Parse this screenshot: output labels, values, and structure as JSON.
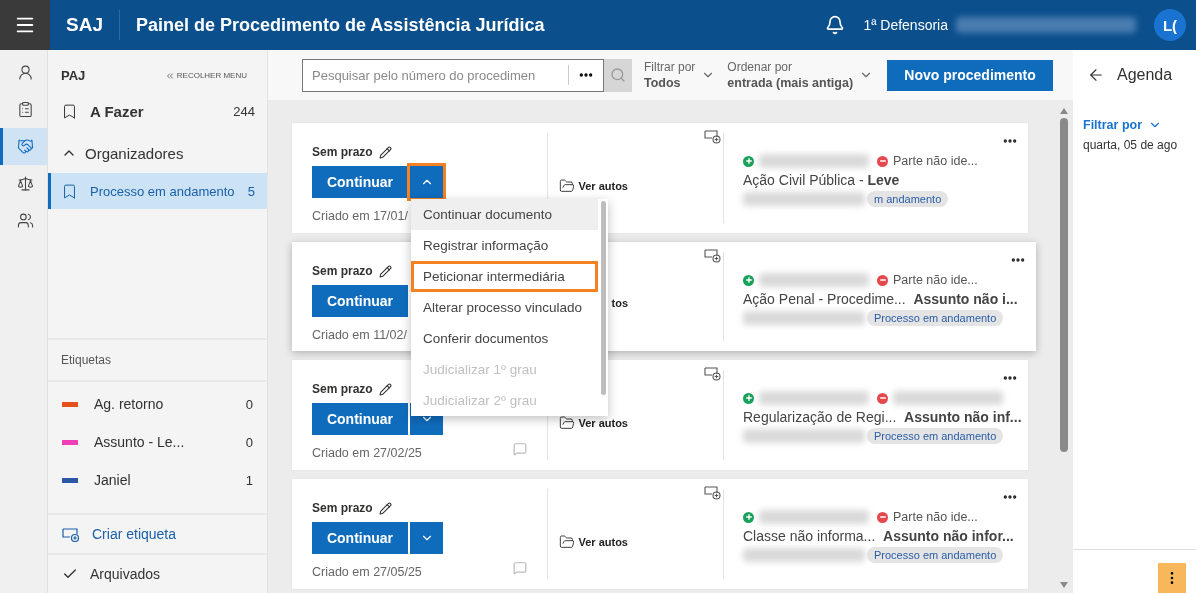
{
  "topbar": {
    "brand": "SAJ",
    "title": "Painel de Procedimento de Assistência Jurídica",
    "unit": "1ª Defensoria",
    "avatar": "L("
  },
  "rail": [
    {
      "kind": "person",
      "selected": false
    },
    {
      "kind": "clipboard",
      "selected": false
    },
    {
      "kind": "handshake",
      "selected": true
    },
    {
      "kind": "scale",
      "selected": false
    },
    {
      "kind": "group",
      "selected": false
    }
  ],
  "sidebar": {
    "title": "PAJ",
    "collapse": "RECOLHER MENU",
    "items": [
      {
        "label": "A Fazer",
        "count": "244",
        "selected": false
      }
    ],
    "organizers": {
      "label": "Organizadores",
      "expanded": true,
      "items": [
        {
          "label": "Processo em andamento",
          "count": "5",
          "selected": true
        }
      ]
    },
    "labels_title": "Etiquetas",
    "labels": [
      {
        "label": "Ag. retorno",
        "count": "0",
        "color": "#e5501c"
      },
      {
        "label": "Assunto - Le...",
        "count": "0",
        "color": "#ee3fb9"
      },
      {
        "label": "Janiel",
        "count": "1",
        "color": "#2b58a6"
      }
    ],
    "create_label": "Criar etiqueta",
    "archived": "Arquivados"
  },
  "toolbar": {
    "search_placeholder": "Pesquisar pelo número do procedimen",
    "filter": {
      "label": "Filtrar por",
      "value": "Todos"
    },
    "sort": {
      "label": "Ordenar por",
      "value": "entrada (mais antiga)"
    },
    "new_button": "Novo procedimento"
  },
  "cards": [
    {
      "deadline": "Sem prazo",
      "action": "Continuar",
      "menu_open": true,
      "dropdown": true,
      "highlighted": true,
      "created": "Criado em 17/01/",
      "comment": false,
      "folder_icon": true,
      "link": "Ver autos",
      "elevated": false,
      "parties": [
        {
          "kind": "plus",
          "redacted": true
        },
        {
          "kind": "minus",
          "name": "Parte não ide..."
        }
      ],
      "title": "Ação Civil Pública - **Leve**",
      "tag": "m andamento"
    },
    {
      "deadline": "Sem prazo",
      "action": "Continuar",
      "menu_open": false,
      "dropdown": false,
      "highlighted": false,
      "created": "Criado em 11/02/",
      "comment": false,
      "folder_icon": false,
      "link": "tos",
      "elevated": true,
      "parties": [
        {
          "kind": "plus",
          "redacted": true
        },
        {
          "kind": "minus",
          "name": "Parte não ide..."
        }
      ],
      "title": "Ação Penal - Procedime...  **Assunto não i...**",
      "tag": "Processo em andamento"
    },
    {
      "deadline": "Sem prazo",
      "action": "Continuar",
      "menu_open": false,
      "dropdown": true,
      "highlighted": false,
      "created": "Criado em 27/02/25",
      "comment": true,
      "folder_icon": true,
      "link": "Ver autos",
      "elevated": false,
      "parties": [
        {
          "kind": "plus",
          "redacted": true
        },
        {
          "kind": "minus",
          "redacted": true
        }
      ],
      "title": "Regularização de Regi...  **Assunto não inf...**",
      "tag": "Processo em andamento"
    },
    {
      "deadline": "Sem prazo",
      "action": "Continuar",
      "menu_open": false,
      "dropdown": true,
      "highlighted": false,
      "created": "Criado em 27/05/25",
      "comment": true,
      "folder_icon": true,
      "link": "Ver autos",
      "elevated": false,
      "parties": [
        {
          "kind": "plus",
          "redacted": true
        },
        {
          "kind": "minus",
          "name": "Parte não ide..."
        }
      ],
      "title": "Classe não informa...  **Assunto não infor...**",
      "tag": "Processo em andamento"
    }
  ],
  "menu": {
    "items": [
      {
        "label": "Continuar documento",
        "hovered": true,
        "disabled": false,
        "highlighted": false
      },
      {
        "label": "Registrar informação",
        "hovered": false,
        "disabled": false,
        "highlighted": false
      },
      {
        "label": "Peticionar intermediária",
        "hovered": false,
        "disabled": false,
        "highlighted": true
      },
      {
        "label": "Alterar processo vinculado",
        "hovered": false,
        "disabled": false,
        "highlighted": false
      },
      {
        "label": "Conferir documentos",
        "hovered": false,
        "disabled": false,
        "highlighted": false
      },
      {
        "label": "Judicializar 1º grau",
        "hovered": false,
        "disabled": true,
        "highlighted": false
      },
      {
        "label": "Judicializar 2º grau",
        "hovered": false,
        "disabled": true,
        "highlighted": false
      }
    ]
  },
  "agenda": {
    "title": "Agenda",
    "filter": "Filtrar por",
    "date": "quarta, 05 de ago"
  }
}
